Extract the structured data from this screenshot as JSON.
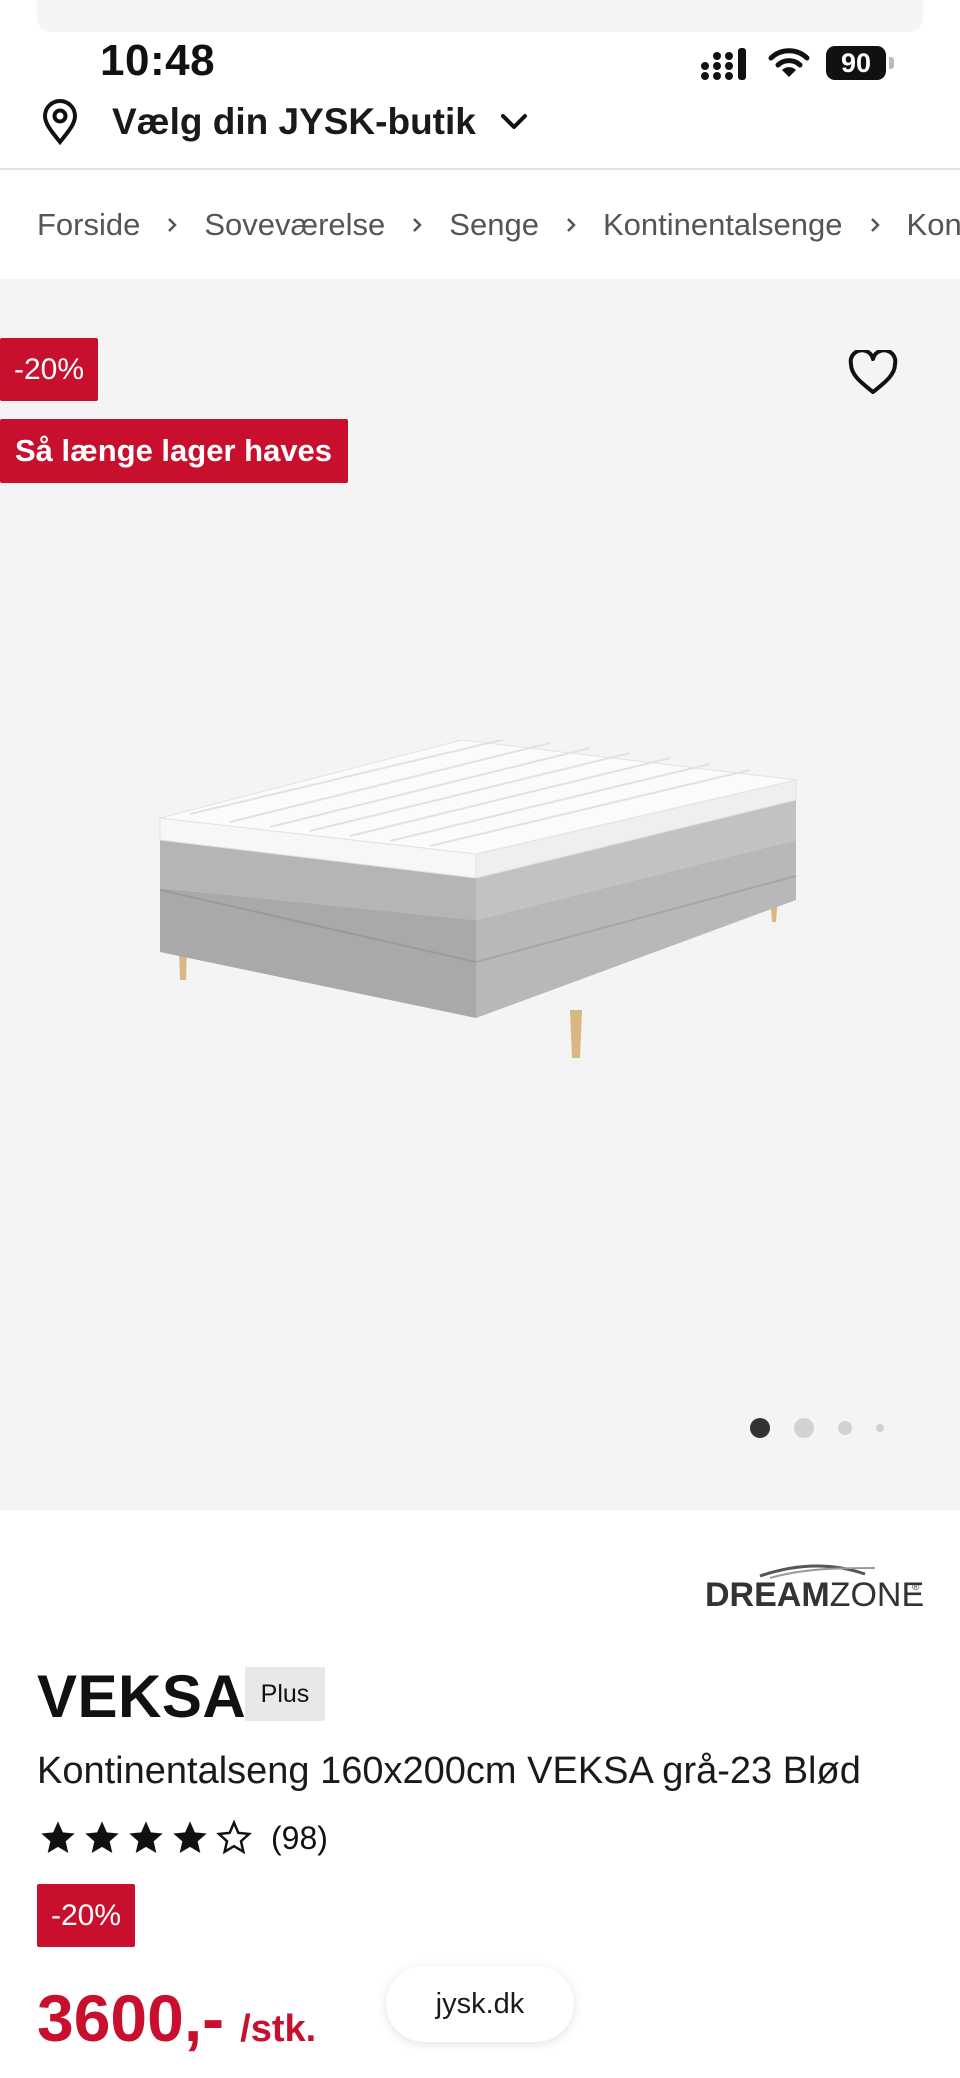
{
  "status_bar": {
    "time": "10:48",
    "battery": "90"
  },
  "store_selector": {
    "label": "Vælg din JYSK-butik"
  },
  "breadcrumb": [
    "Forside",
    "Soveværelse",
    "Senge",
    "Kontinentalsenge",
    "Konti"
  ],
  "gallery": {
    "discount_badge": "-20%",
    "stock_badge": "Så længe lager haves",
    "active_image": 1,
    "image_count": 4
  },
  "product": {
    "brand": "DREAMZONE",
    "name": "VEKSA",
    "tier_badge": "Plus",
    "description": "Kontinentalseng 160x200cm VEKSA grå-23 Blød",
    "rating": 4,
    "rating_max": 5,
    "review_count": "(98)",
    "discount_badge": "-20%",
    "price": "3600,-",
    "price_unit": "/stk."
  },
  "browser": {
    "url": "jysk.dk"
  },
  "colors": {
    "accent": "#c8102e",
    "gallery_bg": "#f4f4f4"
  }
}
